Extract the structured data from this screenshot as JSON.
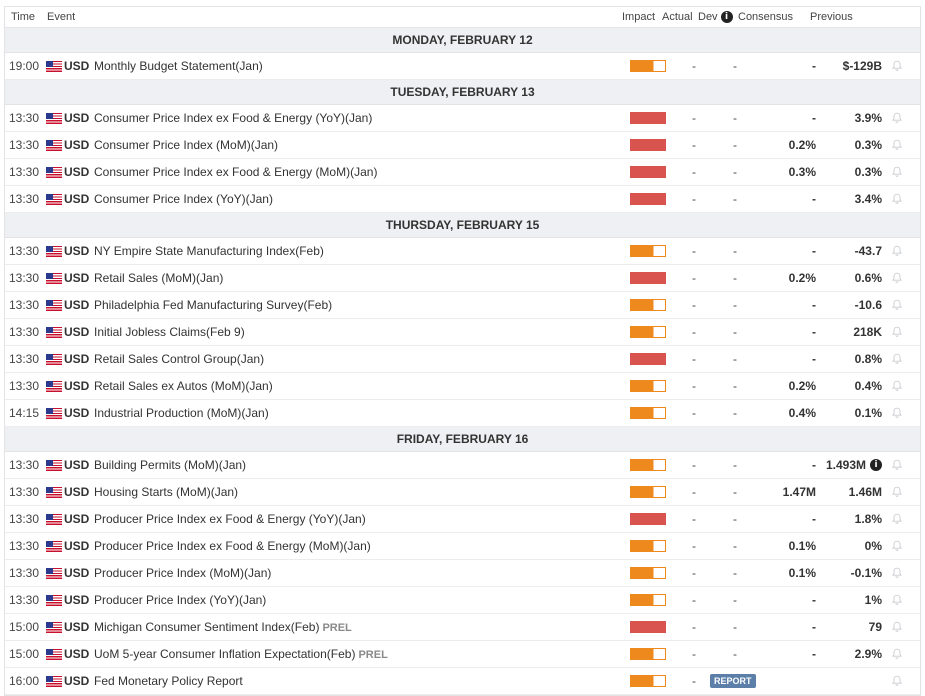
{
  "header": {
    "time": "Time",
    "event": "Event",
    "impact": "Impact",
    "actual": "Actual",
    "dev": "Dev",
    "consensus": "Consensus",
    "previous": "Previous"
  },
  "colors": {
    "high_impact": "#d9534f",
    "medium_impact": "#ee8a1d",
    "report_badge": "#5b7fa8"
  },
  "days": [
    {
      "label": "MONDAY, FEBRUARY 12",
      "events": [
        {
          "time": "19:00",
          "currency": "USD",
          "event": "Monthly Budget Statement(Jan)",
          "prel": "",
          "impact": "medium",
          "actual": "-",
          "dev": "-",
          "consensus": "-",
          "previous": "$-129B"
        }
      ]
    },
    {
      "label": "TUESDAY, FEBRUARY 13",
      "events": [
        {
          "time": "13:30",
          "currency": "USD",
          "event": "Consumer Price Index ex Food & Energy (YoY)(Jan)",
          "prel": "",
          "impact": "high",
          "actual": "-",
          "dev": "-",
          "consensus": "-",
          "previous": "3.9%"
        },
        {
          "time": "13:30",
          "currency": "USD",
          "event": "Consumer Price Index (MoM)(Jan)",
          "prel": "",
          "impact": "high",
          "actual": "-",
          "dev": "-",
          "consensus": "0.2%",
          "previous": "0.3%"
        },
        {
          "time": "13:30",
          "currency": "USD",
          "event": "Consumer Price Index ex Food & Energy (MoM)(Jan)",
          "prel": "",
          "impact": "high",
          "actual": "-",
          "dev": "-",
          "consensus": "0.3%",
          "previous": "0.3%"
        },
        {
          "time": "13:30",
          "currency": "USD",
          "event": "Consumer Price Index (YoY)(Jan)",
          "prel": "",
          "impact": "high",
          "actual": "-",
          "dev": "-",
          "consensus": "-",
          "previous": "3.4%"
        }
      ]
    },
    {
      "label": "THURSDAY, FEBRUARY 15",
      "events": [
        {
          "time": "13:30",
          "currency": "USD",
          "event": "NY Empire State Manufacturing Index(Feb)",
          "prel": "",
          "impact": "medium",
          "actual": "-",
          "dev": "-",
          "consensus": "-",
          "previous": "-43.7"
        },
        {
          "time": "13:30",
          "currency": "USD",
          "event": "Retail Sales (MoM)(Jan)",
          "prel": "",
          "impact": "high",
          "actual": "-",
          "dev": "-",
          "consensus": "0.2%",
          "previous": "0.6%"
        },
        {
          "time": "13:30",
          "currency": "USD",
          "event": "Philadelphia Fed Manufacturing Survey(Feb)",
          "prel": "",
          "impact": "medium",
          "actual": "-",
          "dev": "-",
          "consensus": "-",
          "previous": "-10.6"
        },
        {
          "time": "13:30",
          "currency": "USD",
          "event": "Initial Jobless Claims(Feb 9)",
          "prel": "",
          "impact": "medium",
          "actual": "-",
          "dev": "-",
          "consensus": "-",
          "previous": "218K"
        },
        {
          "time": "13:30",
          "currency": "USD",
          "event": "Retail Sales Control Group(Jan)",
          "prel": "",
          "impact": "high",
          "actual": "-",
          "dev": "-",
          "consensus": "-",
          "previous": "0.8%"
        },
        {
          "time": "13:30",
          "currency": "USD",
          "event": "Retail Sales ex Autos (MoM)(Jan)",
          "prel": "",
          "impact": "medium",
          "actual": "-",
          "dev": "-",
          "consensus": "0.2%",
          "previous": "0.4%"
        },
        {
          "time": "14:15",
          "currency": "USD",
          "event": "Industrial Production (MoM)(Jan)",
          "prel": "",
          "impact": "medium",
          "actual": "-",
          "dev": "-",
          "consensus": "0.4%",
          "previous": "0.1%"
        }
      ]
    },
    {
      "label": "FRIDAY, FEBRUARY 16",
      "events": [
        {
          "time": "13:30",
          "currency": "USD",
          "event": "Building Permits (MoM)(Jan)",
          "prel": "",
          "impact": "medium",
          "actual": "-",
          "dev": "-",
          "consensus": "-",
          "previous": "1.493M",
          "prev_info": true
        },
        {
          "time": "13:30",
          "currency": "USD",
          "event": "Housing Starts (MoM)(Jan)",
          "prel": "",
          "impact": "medium",
          "actual": "-",
          "dev": "-",
          "consensus": "1.47M",
          "previous": "1.46M"
        },
        {
          "time": "13:30",
          "currency": "USD",
          "event": "Producer Price Index ex Food & Energy (YoY)(Jan)",
          "prel": "",
          "impact": "high",
          "actual": "-",
          "dev": "-",
          "consensus": "-",
          "previous": "1.8%"
        },
        {
          "time": "13:30",
          "currency": "USD",
          "event": "Producer Price Index ex Food & Energy (MoM)(Jan)",
          "prel": "",
          "impact": "medium",
          "actual": "-",
          "dev": "-",
          "consensus": "0.1%",
          "previous": "0%"
        },
        {
          "time": "13:30",
          "currency": "USD",
          "event": "Producer Price Index (MoM)(Jan)",
          "prel": "",
          "impact": "medium",
          "actual": "-",
          "dev": "-",
          "consensus": "0.1%",
          "previous": "-0.1%"
        },
        {
          "time": "13:30",
          "currency": "USD",
          "event": "Producer Price Index (YoY)(Jan)",
          "prel": "",
          "impact": "medium",
          "actual": "-",
          "dev": "-",
          "consensus": "-",
          "previous": "1%"
        },
        {
          "time": "15:00",
          "currency": "USD",
          "event": "Michigan Consumer Sentiment Index(Feb)",
          "prel": "PREL",
          "impact": "high",
          "actual": "-",
          "dev": "-",
          "consensus": "-",
          "previous": "79"
        },
        {
          "time": "15:00",
          "currency": "USD",
          "event": "UoM 5-year Consumer Inflation Expectation(Feb)",
          "prel": "PREL",
          "impact": "medium",
          "actual": "-",
          "dev": "-",
          "consensus": "-",
          "previous": "2.9%"
        },
        {
          "time": "16:00",
          "currency": "USD",
          "event": "Fed Monetary Policy Report",
          "prel": "",
          "impact": "medium",
          "actual": "-",
          "report": "REPORT"
        }
      ]
    }
  ]
}
